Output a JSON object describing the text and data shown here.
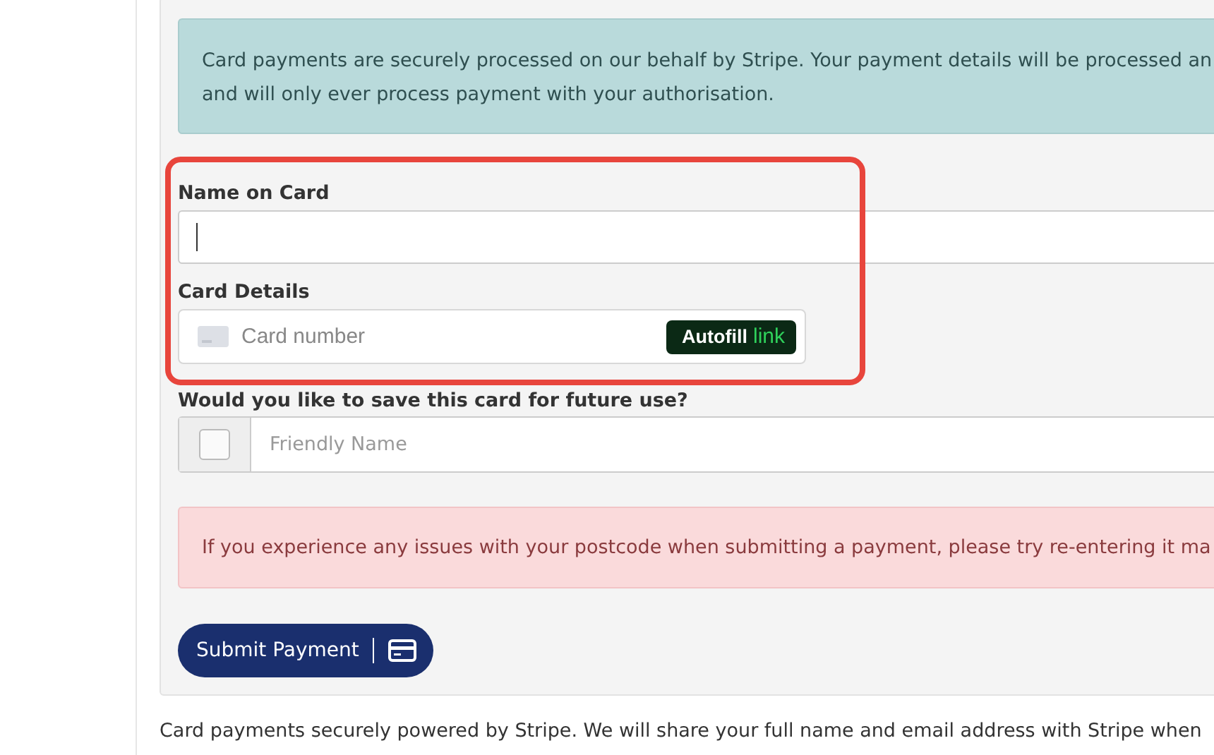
{
  "info_notice": {
    "lines": [
      "Card payments are securely processed on our behalf by Stripe. Your payment details will be processed an",
      "and will only ever process payment with your authorisation."
    ]
  },
  "name_field": {
    "label": "Name on Card"
  },
  "card_field": {
    "label": "Card Details",
    "placeholder": "Card number",
    "autofill_button": {
      "label": "Autofill",
      "brand": "link"
    }
  },
  "save_card": {
    "question": "Would you like to save this card for future use?",
    "checked": false,
    "placeholder": "Friendly Name"
  },
  "warning_notice": {
    "text": "If you experience any issues with your postcode when submitting a payment, please try re-entering it ma"
  },
  "submit_button": {
    "label": "Submit Payment"
  },
  "footer_text": "Card payments securely powered by Stripe. We will share your full name and email address with Stripe when"
}
